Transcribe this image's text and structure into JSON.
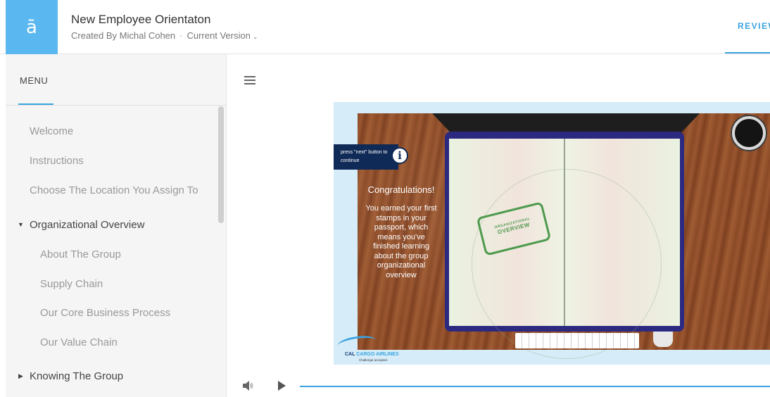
{
  "header": {
    "logo_glyph": "ā",
    "title": "New Employee Orientaton",
    "created_by": "Created By Michal Cohen",
    "separator": "·",
    "version": "Current Version",
    "review_tab": "REVIEW"
  },
  "sidebar": {
    "menu_label": "MENU",
    "items": [
      {
        "label": "Welcome"
      },
      {
        "label": "Instructions"
      },
      {
        "label": "Choose The Location You Assign To"
      },
      {
        "label": "Organizational Overview",
        "expanded": true
      },
      {
        "label": "About The Group"
      },
      {
        "label": "Supply Chain"
      },
      {
        "label": "Our Core Business Process"
      },
      {
        "label": "Our Value Chain"
      },
      {
        "label": "Knowing The Group",
        "expanded": false
      }
    ]
  },
  "slide": {
    "press_next": "press \"next\" button to continue",
    "info_glyph": "i",
    "congrats_title": "Congratulations!",
    "congrats_body": "You earned your first stamps in your passport, which means you've finished learning about the group organizational overview",
    "stamp_top": "ORGANIZATIONAL",
    "stamp_main": "OVERVIEW",
    "brand_cal": "CAL",
    "brand_rest": "CARGO AIRLINES",
    "brand_tagline": "Challenge accepted."
  },
  "colors": {
    "accent": "#3aa4e0",
    "logo_bg": "#5bb7f0",
    "sidebar_bg": "#f5f5f5",
    "slide_navy": "#0f2a56"
  },
  "icons": {
    "menu": "hamburger-icon",
    "volume": "volume-icon",
    "play": "play-icon",
    "caret_expanded": "caret-down-icon",
    "caret_collapsed": "caret-right-icon",
    "version_dropdown": "chevron-down-icon"
  }
}
